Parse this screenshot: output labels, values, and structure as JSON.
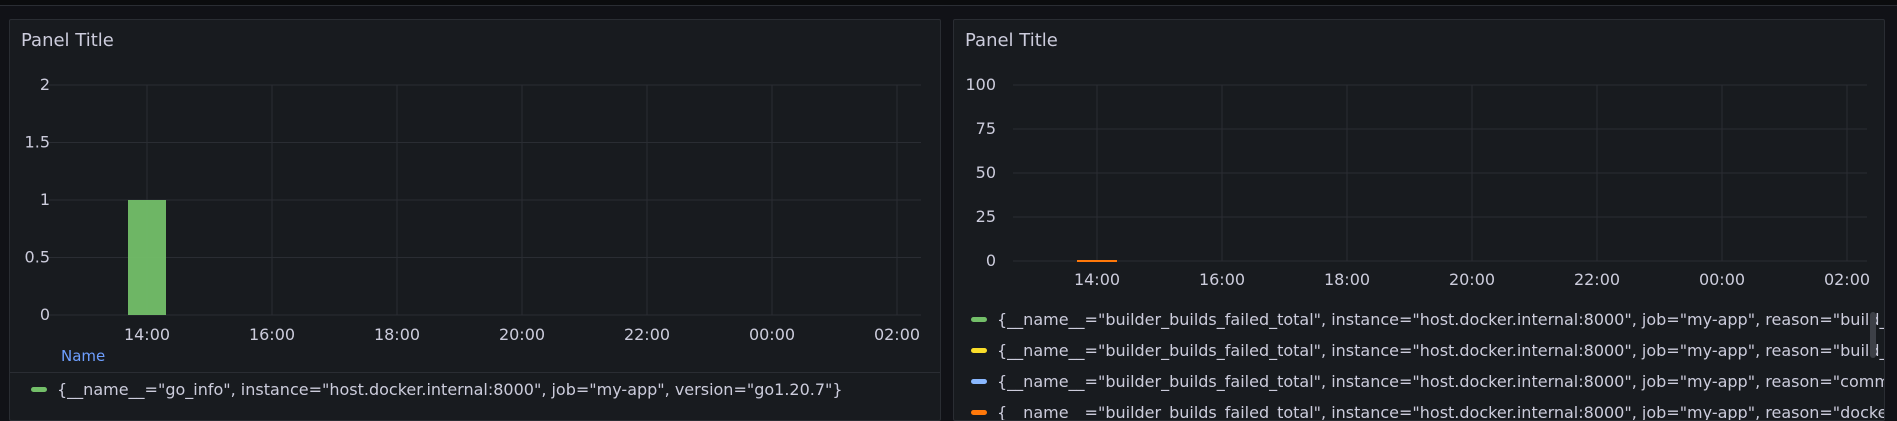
{
  "panels": [
    {
      "title": "Panel Title",
      "chart_data": {
        "type": "bar",
        "x_tick_labels": [
          "14:00",
          "16:00",
          "18:00",
          "20:00",
          "22:00",
          "00:00",
          "02:00"
        ],
        "y_tick_labels": [
          "0",
          "0.5",
          "1",
          "1.5",
          "2"
        ],
        "ylim": [
          0,
          2
        ],
        "series": [
          {
            "name": "{__name__=\"go_info\", instance=\"host.docker.internal:8000\", job=\"my-app\", version=\"go1.20.7\"}",
            "color": "#73bf69",
            "x": [
              "14:00"
            ],
            "values": [
              1
            ]
          }
        ],
        "grid": true,
        "legend_placement": "bottom"
      },
      "legend": {
        "header": "Name",
        "items": [
          {
            "label": "{__name__=\"go_info\", instance=\"host.docker.internal:8000\", job=\"my-app\", version=\"go1.20.7\"}",
            "color": "#73bf69"
          }
        ]
      }
    },
    {
      "title": "Panel Title",
      "chart_data": {
        "type": "line",
        "x_tick_labels": [
          "14:00",
          "16:00",
          "18:00",
          "20:00",
          "22:00",
          "00:00",
          "02:00"
        ],
        "y_tick_labels": [
          "0",
          "25",
          "50",
          "75",
          "100"
        ],
        "ylim": [
          0,
          100
        ],
        "series": [
          {
            "name": "{__name__=\"builder_builds_failed_total\", instance=\"host.docker.internal:8000\", job=\"my-app\", reason=\"build_can",
            "color": "#73bf69",
            "x": [
              "14:00"
            ],
            "values": [
              0
            ]
          },
          {
            "name": "{__name__=\"builder_builds_failed_total\", instance=\"host.docker.internal:8000\", job=\"my-app\", reason=\"build_targ",
            "color": "#fade2a",
            "x": [
              "14:00"
            ],
            "values": [
              0
            ]
          },
          {
            "name": "{__name__=\"builder_builds_failed_total\", instance=\"host.docker.internal:8000\", job=\"my-app\", reason=\"command",
            "color": "#8ab8ff",
            "x": [
              "14:00"
            ],
            "values": [
              0
            ]
          },
          {
            "name": "{__name__=\"builder_builds_failed_total\", instance=\"host.docker.internal:8000\", job=\"my-app\", reason=\"dockerfile",
            "color": "#ff780a",
            "x": [
              "14:00"
            ],
            "values": [
              0
            ]
          }
        ],
        "grid": true,
        "legend_placement": "bottom"
      },
      "legend": {
        "items": [
          {
            "label": "{__name__=\"builder_builds_failed_total\", instance=\"host.docker.internal:8000\", job=\"my-app\", reason=\"build_can",
            "color": "#73bf69"
          },
          {
            "label": "{__name__=\"builder_builds_failed_total\", instance=\"host.docker.internal:8000\", job=\"my-app\", reason=\"build_targ",
            "color": "#fade2a"
          },
          {
            "label": "{__name__=\"builder_builds_failed_total\", instance=\"host.docker.internal:8000\", job=\"my-app\", reason=\"command",
            "color": "#8ab8ff"
          },
          {
            "label": "{__name__=\"builder_builds_failed_total\", instance=\"host.docker.internal:8000\", job=\"my-app\", reason=\"dockerfile",
            "color": "#ff780a"
          }
        ]
      }
    }
  ]
}
